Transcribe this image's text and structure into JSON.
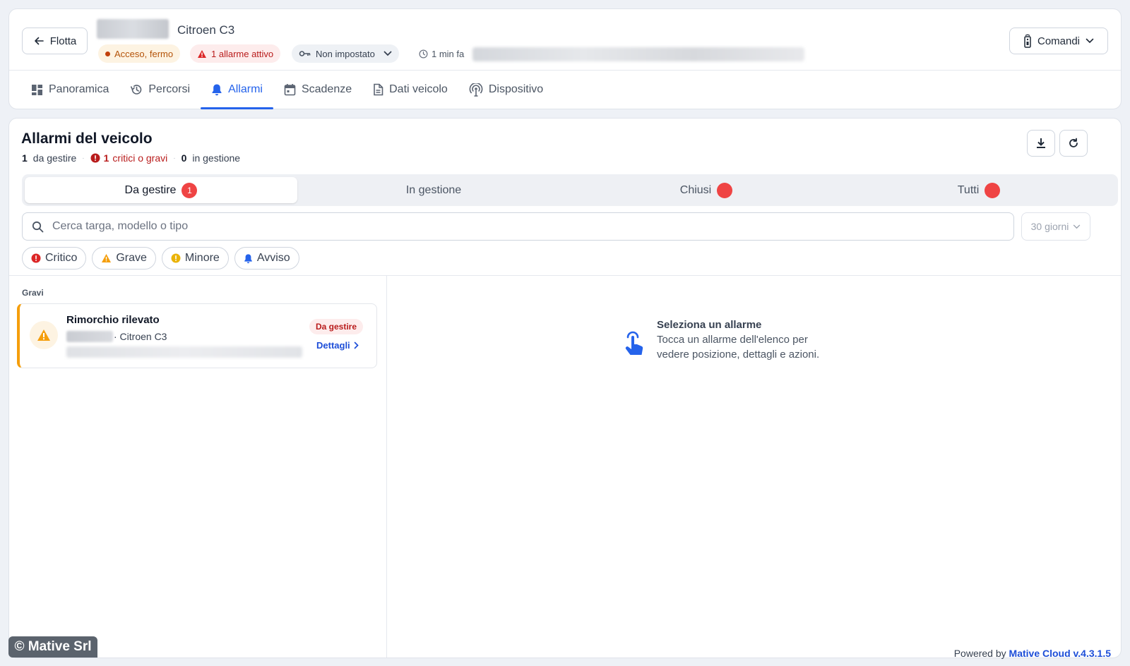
{
  "header": {
    "back_label": "Flotta",
    "vehicle_model": "Citroen C3",
    "status_chip": "Acceso, fermo",
    "alarm_chip": "1 allarme attivo",
    "driver_chip": "Non impostato",
    "time_ago": "1 min fa",
    "commands_label": "Comandi"
  },
  "tabs": [
    {
      "label": "Panoramica",
      "icon": "dashboard-icon"
    },
    {
      "label": "Percorsi",
      "icon": "history-icon"
    },
    {
      "label": "Allarmi",
      "icon": "bell-icon",
      "active": true
    },
    {
      "label": "Scadenze",
      "icon": "calendar-icon"
    },
    {
      "label": "Dati veicolo",
      "icon": "document-icon"
    },
    {
      "label": "Dispositivo",
      "icon": "antenna-icon"
    }
  ],
  "main": {
    "title": "Allarmi del veicolo",
    "stats": {
      "to_manage_count": "1",
      "to_manage_label": "da gestire",
      "critical_count": "1",
      "critical_label": "critici o gravi",
      "in_progress_count": "0",
      "in_progress_label": "in gestione"
    },
    "segments": [
      {
        "label": "Da gestire",
        "badge": "1",
        "active": true
      },
      {
        "label": "In gestione",
        "badge": ""
      },
      {
        "label": "Chiusi",
        "badge": ""
      },
      {
        "label": "Tutti",
        "badge": ""
      }
    ],
    "search_placeholder": "Cerca targa, modello o tipo",
    "range_value": "30 giorni",
    "filters": [
      {
        "label": "Critico",
        "icon": "critical-icon",
        "color": "#dc2626"
      },
      {
        "label": "Grave",
        "icon": "warning-icon",
        "color": "#f59e0b"
      },
      {
        "label": "Minore",
        "icon": "minor-icon",
        "color": "#eab308"
      },
      {
        "label": "Avviso",
        "icon": "bell-icon",
        "color": "#2563eb"
      }
    ],
    "group_label": "Gravi",
    "alarm": {
      "title": "Rimorchio rilevato",
      "model": "· Citroen C3",
      "badge": "Da gestire",
      "details_label": "Dettagli"
    },
    "empty": {
      "title": "Seleziona un allarme",
      "text_line1": "Tocca un allarme dell'elenco per",
      "text_line2": "vedere posizione, dettagli e azioni."
    }
  },
  "footer": {
    "copyright": "© Mative Srl",
    "powered_prefix": "Powered by",
    "powered_brand": "Mative Cloud v.4.3.1.5"
  },
  "colors": {
    "accent": "#2563eb",
    "danger": "#ef4444",
    "warning": "#f59e0b"
  }
}
